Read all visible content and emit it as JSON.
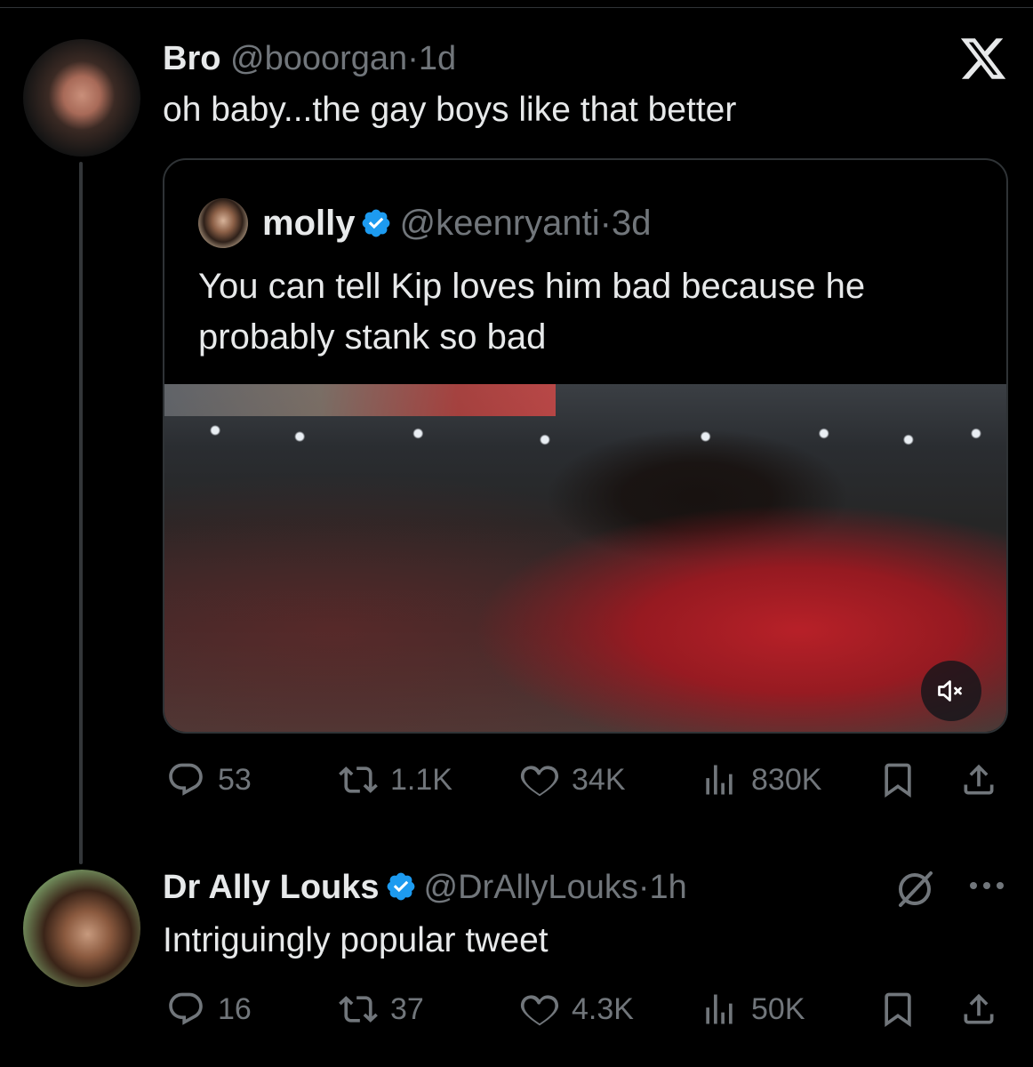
{
  "tweet_bro": {
    "name": "Bro",
    "handle": "@booorgan",
    "sep": "·",
    "time": "1d",
    "text": "oh baby...the gay boys like that better",
    "stats": {
      "replies": "53",
      "reposts": "1.1K",
      "likes": "34K",
      "views": "830K"
    }
  },
  "quoted_tweet": {
    "name": "molly",
    "handle": "@keenryanti",
    "sep": "·",
    "time": "3d",
    "text": "You can tell Kip loves him bad because he probably stank so bad",
    "media_icon": "mute-icon"
  },
  "tweet_ally": {
    "name": "Dr Ally Louks",
    "handle": "@DrAllyLouks",
    "sep": "·",
    "time": "1h",
    "text": "Intriguingly popular tweet",
    "stats": {
      "replies": "16",
      "reposts": "37",
      "likes": "4.3K",
      "views": "50K"
    }
  },
  "icons": {
    "logo": "x-logo-icon",
    "verified": "verified-badge-icon",
    "reply": "reply-icon",
    "repost": "repost-icon",
    "like": "like-icon",
    "views": "views-icon",
    "bookmark": "bookmark-icon",
    "share": "share-icon",
    "grok": "grok-icon",
    "more": "more-icon"
  },
  "colors": {
    "background": "#000000",
    "text": "#e7e9ea",
    "secondary": "#71767b",
    "border": "#2f3336",
    "verified": "#1d9bf0"
  }
}
